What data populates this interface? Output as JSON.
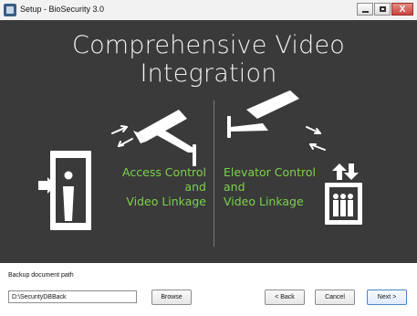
{
  "window": {
    "title": "Setup - BioSecurity 3.0",
    "controls": {
      "minimize_icon": "minimize-icon",
      "maximize_icon": "maximize-icon",
      "close_icon": "close-icon",
      "close_glyph": "X"
    }
  },
  "hero": {
    "headline": "Comprehensive Video Integration",
    "left_text": [
      "Access Control",
      "and",
      "Video Linkage"
    ],
    "right_text": [
      "Elevator Control",
      "and",
      "Video Linkage"
    ],
    "accent_color": "#7bd24a"
  },
  "backup": {
    "label": "Backup document path",
    "path_value": "D:\\SecurityDBBack"
  },
  "buttons": {
    "browse": "Browse",
    "back": "< Back",
    "cancel": "Cancel",
    "next": "Next >"
  }
}
